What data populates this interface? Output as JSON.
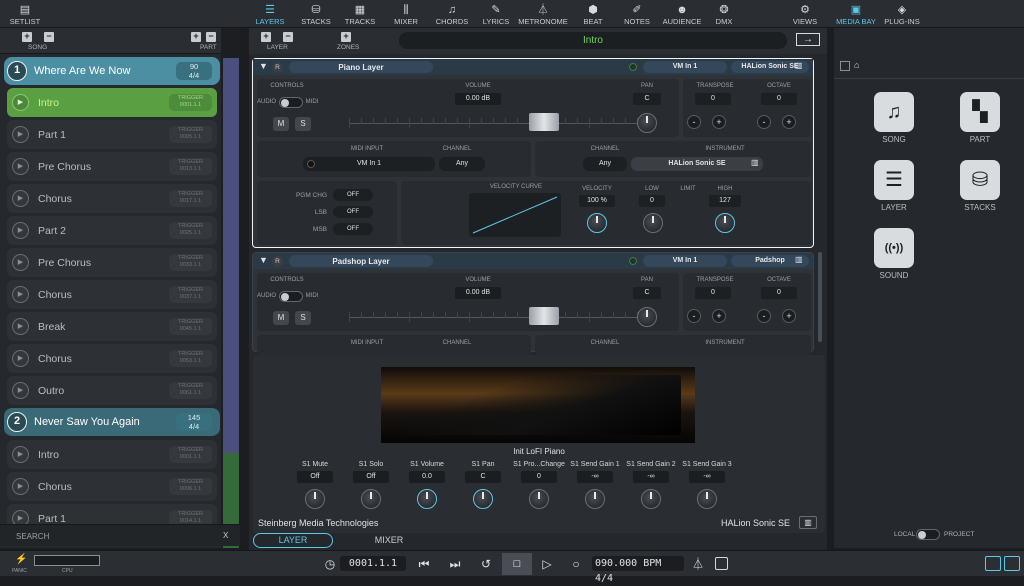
{
  "topbar": {
    "setlist": "SETLIST",
    "tabs": [
      {
        "label": "LAYERS",
        "icon": "layers-icon",
        "glyph": "☰",
        "active": true
      },
      {
        "label": "STACKS",
        "icon": "stacks-icon",
        "glyph": "⛁",
        "active": false
      },
      {
        "label": "TRACKS",
        "icon": "tracks-icon",
        "glyph": "▦",
        "active": false
      },
      {
        "label": "MIXER",
        "icon": "mixer-icon",
        "glyph": "⫼",
        "active": false
      },
      {
        "label": "CHORDS",
        "icon": "chords-icon",
        "glyph": "♫",
        "active": false
      },
      {
        "label": "LYRICS",
        "icon": "lyrics-icon",
        "glyph": "✎",
        "active": false
      },
      {
        "label": "METRONOME",
        "icon": "metronome-icon",
        "glyph": "⏃",
        "active": false
      },
      {
        "label": "BEAT",
        "icon": "beat-icon",
        "glyph": "⬢",
        "active": false
      },
      {
        "label": "NOTES",
        "icon": "notes-icon",
        "glyph": "✐",
        "active": false
      },
      {
        "label": "AUDIENCE",
        "icon": "audience-icon",
        "glyph": "☻",
        "active": false
      },
      {
        "label": "DMX",
        "icon": "dmx-icon",
        "glyph": "❂",
        "active": false
      },
      {
        "label": "VIEWS",
        "icon": "views-icon",
        "glyph": "⚙",
        "active": false
      }
    ],
    "media_bay": "MEDIA BAY",
    "plug_ins": "PLUG-INS"
  },
  "setlist": {
    "song_label": "SONG",
    "part_label": "PART",
    "songs": [
      {
        "num": "1",
        "name": "Where Are We Now",
        "tempo": "90",
        "sig": "4/4"
      },
      {
        "num": "2",
        "name": "Never Saw You Again",
        "tempo": "145",
        "sig": "4/4"
      }
    ],
    "parts1": [
      {
        "name": "Intro",
        "trigger": "TRIGGER",
        "pos": "0001.1.1",
        "sel": true
      },
      {
        "name": "Part 1",
        "trigger": "TRIGGER",
        "pos": "0005.1.1",
        "sel": false
      },
      {
        "name": "Pre Chorus",
        "trigger": "TRIGGER",
        "pos": "0013.1.1",
        "sel": false
      },
      {
        "name": "Chorus",
        "trigger": "TRIGGER",
        "pos": "0017.1.1",
        "sel": false
      },
      {
        "name": "Part 2",
        "trigger": "TRIGGER",
        "pos": "0025.1.1",
        "sel": false
      },
      {
        "name": "Pre Chorus",
        "trigger": "TRIGGER",
        "pos": "0033.1.1",
        "sel": false
      },
      {
        "name": "Chorus",
        "trigger": "TRIGGER",
        "pos": "0037.1.1",
        "sel": false
      },
      {
        "name": "Break",
        "trigger": "TRIGGER",
        "pos": "0045.1.1",
        "sel": false
      },
      {
        "name": "Chorus",
        "trigger": "TRIGGER",
        "pos": "0053.1.1",
        "sel": false
      },
      {
        "name": "Outro",
        "trigger": "TRIGGER",
        "pos": "0061.1.1",
        "sel": false
      }
    ],
    "parts2": [
      {
        "name": "Intro",
        "trigger": "TRIGGER",
        "pos": "0001.1.1",
        "sel": false
      },
      {
        "name": "Chorus",
        "trigger": "TRIGGER",
        "pos": "0006.1.1",
        "sel": false
      },
      {
        "name": "Part 1",
        "trigger": "TRIGGER",
        "pos": "0014.1.1",
        "sel": false
      }
    ],
    "search": "SEARCH",
    "search_clear": "X"
  },
  "center": {
    "layer_label": "LAYER",
    "zones_label": "ZONES",
    "current_part": "Intro",
    "layers": [
      {
        "title": "Piano Layer",
        "midi": "VM In 1",
        "instrument": "HALion Sonic SE",
        "volume": "0.00 dB",
        "pan": "C",
        "transpose": "0",
        "octave": "0",
        "midi_input": "VM In 1",
        "channel": "Any",
        "inst_channel": "Any",
        "inst_name": "HALion Sonic SE",
        "velocity": "100 %",
        "low": "0",
        "high": "127"
      },
      {
        "title": "Padshop Layer",
        "midi": "VM In 1",
        "instrument": "Padshop",
        "volume": "0.00 dB",
        "pan": "C",
        "transpose": "0",
        "octave": "0"
      }
    ],
    "labels": {
      "controls": "CONTROLS",
      "volume": "VOLUME",
      "pan": "PAN",
      "transpose": "TRANSPOSE",
      "octave": "OCTAVE",
      "audio": "AUDIO",
      "midi": "MIDI",
      "m": "M",
      "s": "S",
      "midi_input": "MIDI INPUT",
      "channel": "CHANNEL",
      "instrument": "INSTRUMENT",
      "pgm_chg": "PGM CHG",
      "lsb": "LSB",
      "msb": "MSB",
      "off": "OFF",
      "velocity_curve": "VELOCITY CURVE",
      "velocity": "VELOCITY",
      "low": "LOW",
      "limit": "LIMIT",
      "high": "HIGH",
      "minus": "-",
      "plus": "+",
      "r": "R"
    },
    "plugin": {
      "preset": "Init LoFI Piano",
      "vendor": "Steinberg Media Technologies",
      "product": "HALion Sonic SE",
      "params": [
        {
          "name": "S1 Mute",
          "value": "Off",
          "blue": false
        },
        {
          "name": "S1 Solo",
          "value": "Off",
          "blue": false
        },
        {
          "name": "S1 Volume",
          "value": "0.0",
          "blue": true
        },
        {
          "name": "S1 Pan",
          "value": "C",
          "blue": true
        },
        {
          "name": "S1 Pro...Change",
          "value": "0",
          "blue": false
        },
        {
          "name": "S1 Send Gain 1",
          "value": "-∞",
          "blue": false
        },
        {
          "name": "S1 Send Gain 2",
          "value": "-∞",
          "blue": false
        },
        {
          "name": "S1 Send Gain 3",
          "value": "-∞",
          "blue": false
        }
      ]
    },
    "bottom_tabs": {
      "layer": "LAYER",
      "mixer": "MIXER"
    }
  },
  "mediabay": {
    "tiles": [
      {
        "label": "SONG",
        "icon": "song-icon",
        "glyph": "♫"
      },
      {
        "label": "PART",
        "icon": "part-icon",
        "glyph": "▚"
      },
      {
        "label": "LAYER",
        "icon": "layer-icon",
        "glyph": "☰"
      },
      {
        "label": "STACKS",
        "icon": "stacks-icon",
        "glyph": "⛁"
      },
      {
        "label": "SOUND",
        "icon": "sound-icon",
        "glyph": "((•))"
      }
    ],
    "local": "LOCAL",
    "project": "PROJECT"
  },
  "transport": {
    "panic": "PANIC",
    "cpu": "CPU",
    "position": "0001.1.1",
    "tempo": "090.000",
    "bpm": "BPM",
    "signature": "4/4"
  }
}
